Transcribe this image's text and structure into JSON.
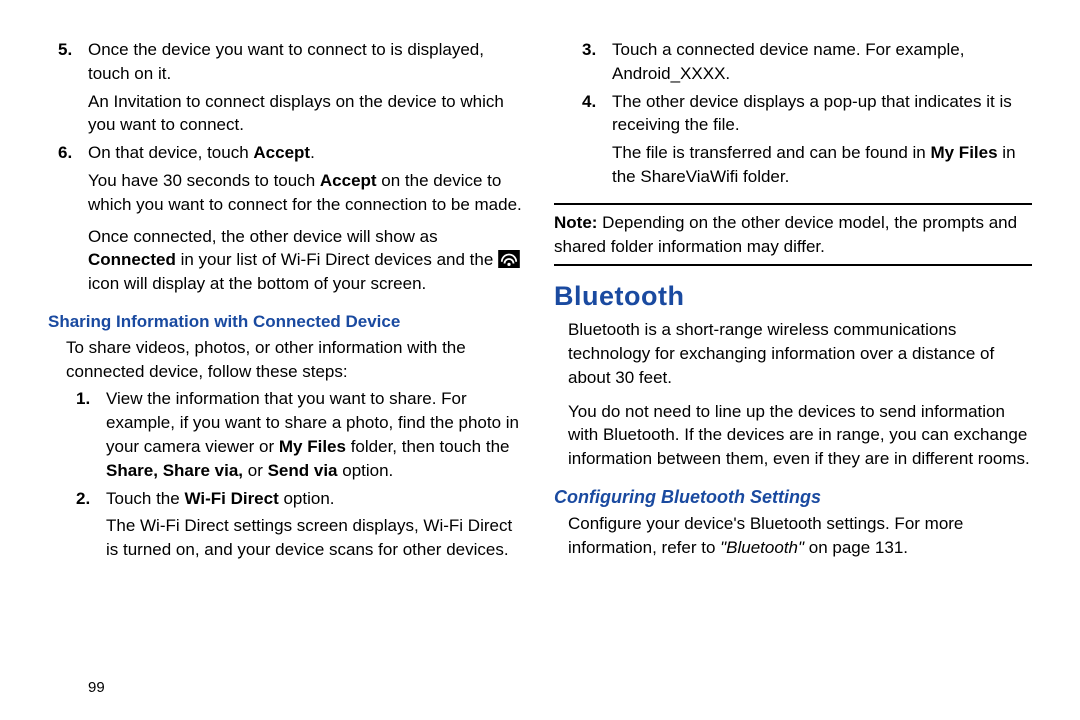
{
  "left": {
    "items5_a": "Once the device you want to connect to is displayed, touch on it.",
    "items5_b": "An Invitation to connect displays on the device to which you want to connect.",
    "items6_a1": "On that device, touch ",
    "items6_a_bold": "Accept",
    "items6_a2": ".",
    "items6_b1": "You have 30 seconds to touch ",
    "items6_b_bold": "Accept",
    "items6_b2": " on the device to which you want to connect for the connection to be made.",
    "items6_c1": "Once connected, the other device will show as ",
    "items6_c_bold": "Connected",
    "items6_c2": " in your list of Wi-Fi Direct devices and the ",
    "items6_c3": " icon will display at the bottom of your screen.",
    "sub_heading": "Sharing Information with Connected Device",
    "intro": "To share videos, photos, or other information with the connected device, follow these steps:",
    "s1_a": "View the information that you want to share. For example, if you want to share a photo, find the photo in your camera viewer or ",
    "s1_bold1": "My Files",
    "s1_b": " folder, then touch the ",
    "s1_bold2": "Share, Share via,",
    "s1_c": " or ",
    "s1_bold3": "Send via",
    "s1_d": " option.",
    "s2_a": "Touch the ",
    "s2_bold": "Wi-Fi Direct",
    "s2_b": " option.",
    "s2_c": "The Wi-Fi Direct settings screen displays, Wi-Fi Direct is turned on, and your device scans for other devices.",
    "page": "99"
  },
  "right": {
    "s3_a": "Touch a connected device name. For example, Android_XXXX.",
    "s4_a": "The other device displays a pop-up that indicates it is receiving the file.",
    "s4_b1": "The file is transferred and can be found in ",
    "s4_bold": "My Files",
    "s4_b2": " in the ShareViaWifi folder.",
    "note_bold": "Note:",
    "note": " Depending on the other device model, the prompts and shared folder information may differ.",
    "section": "Bluetooth",
    "bt1": "Bluetooth is a short-range wireless communications technology for exchanging information over a distance of about 30 feet.",
    "bt2": "You do not need to line up the devices to send information with Bluetooth. If the devices are in range, you can exchange information between them, even if they are in different rooms.",
    "sub_heading": "Configuring Bluetooth Settings",
    "cfg1": "Configure your device's Bluetooth settings. For more information, refer to ",
    "cfg_ref": "\"Bluetooth\"",
    "cfg2": " on page 131."
  },
  "markers": {
    "m5": "5.",
    "m6": "6.",
    "m1": "1.",
    "m2": "2.",
    "m3": "3.",
    "m4": "4."
  }
}
